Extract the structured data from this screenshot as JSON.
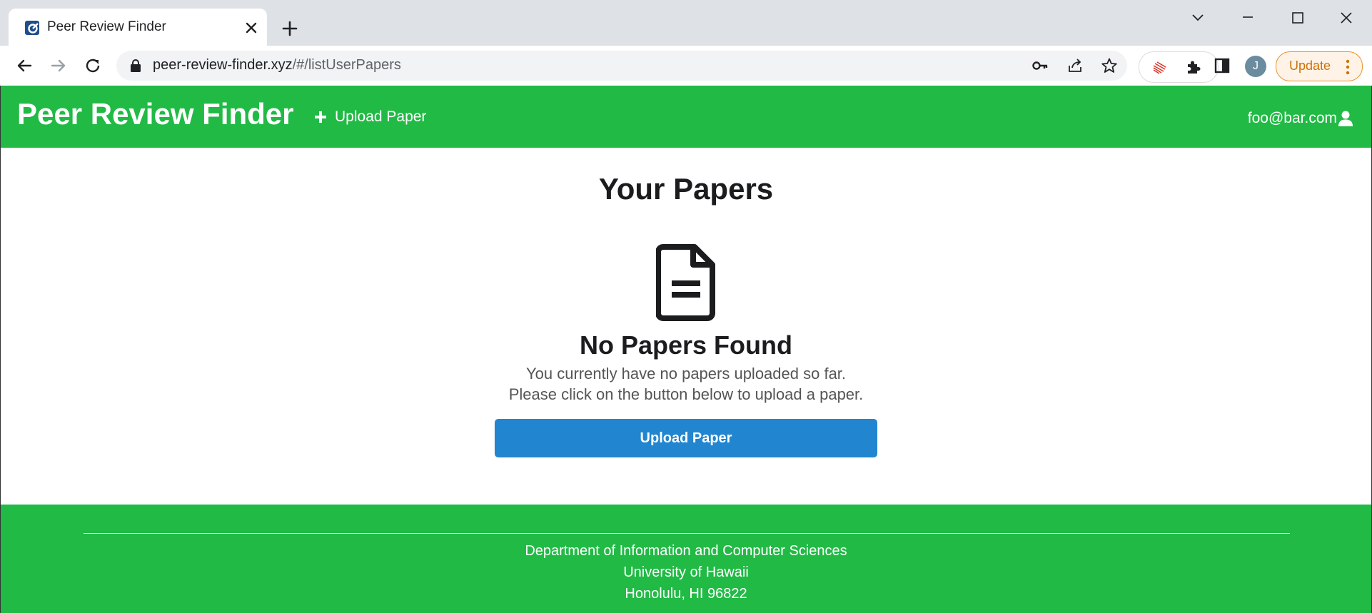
{
  "browser": {
    "tab_title": "Peer Review Finder",
    "url_host": "peer-review-finder.xyz",
    "url_path": "/#/listUserPapers",
    "profile_initial": "J",
    "update_label": "Update"
  },
  "app": {
    "brand": "Peer Review Finder",
    "nav_upload_label": "Upload Paper",
    "user_email": "foo@bar.com"
  },
  "main": {
    "heading": "Your Papers",
    "empty_title": "No Papers Found",
    "empty_line1": "You currently have no papers uploaded so far.",
    "empty_line2": "Please click on the button below to upload a paper.",
    "upload_button_label": "Upload Paper"
  },
  "footer": {
    "line1": "Department of Information and Computer Sciences",
    "line2": "University of Hawaii",
    "line3": "Honolulu, HI 96822"
  },
  "colors": {
    "brand_green": "#21ba45",
    "primary_blue": "#2185d0",
    "update_orange": "#d16f04"
  },
  "icons": {
    "tab_favicon": "app-favicon-icon",
    "close": "close-icon",
    "new_tab": "plus-icon",
    "back": "arrow-left-icon",
    "forward": "arrow-right-icon",
    "reload": "reload-icon",
    "lock": "lock-icon",
    "key": "key-icon",
    "share": "share-icon",
    "star": "star-icon",
    "extensions": "puzzle-icon",
    "side_panel": "side-panel-icon",
    "menu": "kebab-icon",
    "upload_plus": "plus-icon",
    "user": "user-icon",
    "empty_state": "file-text-icon"
  }
}
